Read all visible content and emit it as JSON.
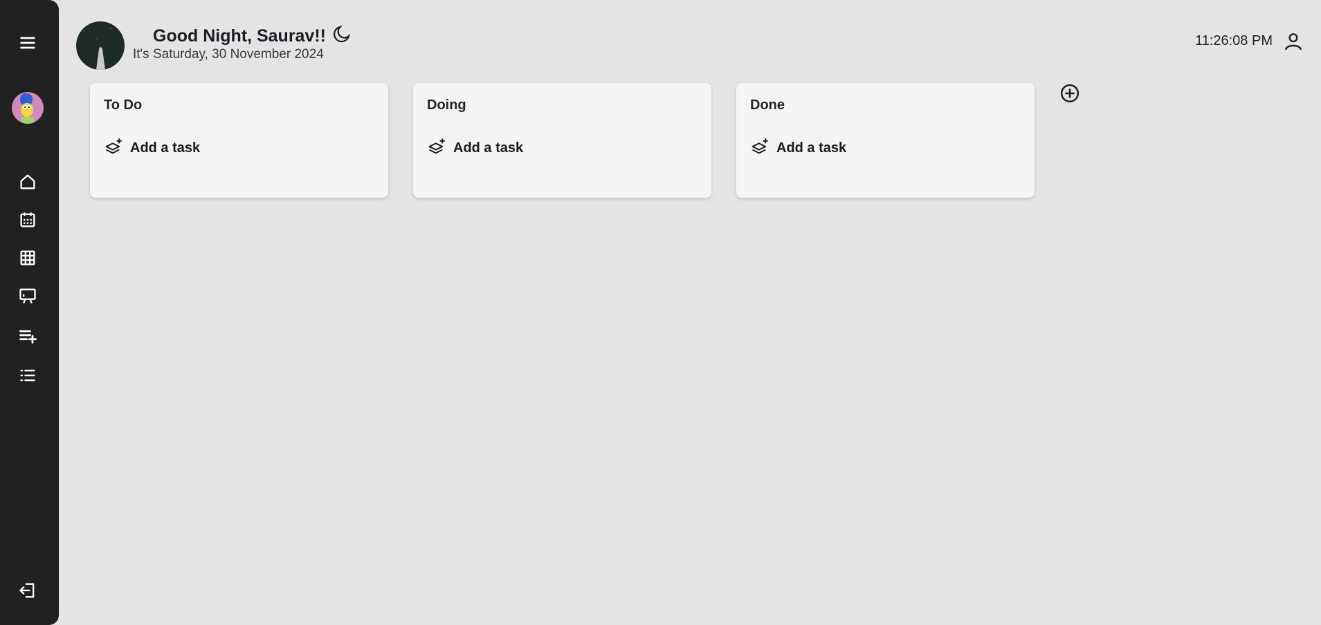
{
  "header": {
    "greeting": "Good Night, Saurav!!",
    "date_line": "It's Saturday, 30 November 2024",
    "time": "11:26:08 PM"
  },
  "sidebar": {
    "items": [
      {
        "name": "home",
        "icon": "home-icon"
      },
      {
        "name": "calendar",
        "icon": "calendar-icon"
      },
      {
        "name": "grid",
        "icon": "grid-icon"
      },
      {
        "name": "board",
        "icon": "presentation-icon"
      },
      {
        "name": "add-list",
        "icon": "playlist-add-icon"
      },
      {
        "name": "list",
        "icon": "list-icon"
      }
    ]
  },
  "boards": [
    {
      "title": "To Do",
      "add_label": "Add a task"
    },
    {
      "title": "Doing",
      "add_label": "Add a task"
    },
    {
      "title": "Done",
      "add_label": "Add a task"
    }
  ],
  "colors": {
    "sidebar_bg": "#212121",
    "page_bg": "#e4e4e4",
    "card_bg": "#f4f4f4"
  }
}
